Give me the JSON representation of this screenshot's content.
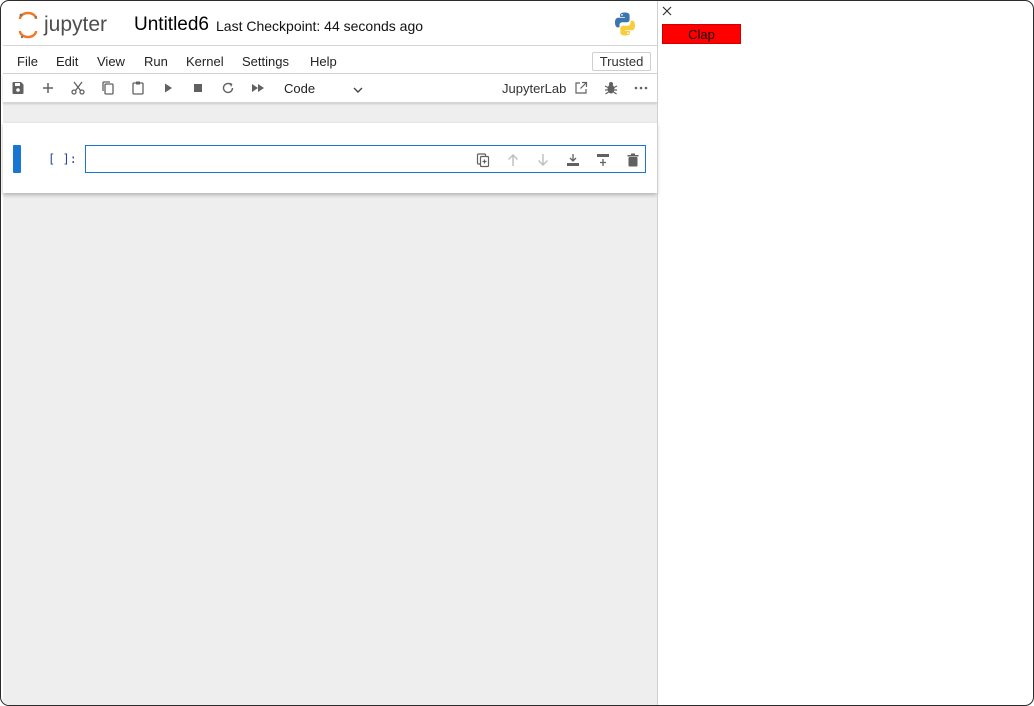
{
  "header": {
    "logo_text": "jupyter",
    "notebook_title": "Untitled6",
    "checkpoint": "Last Checkpoint: 44 seconds ago"
  },
  "menubar": {
    "items": [
      "File",
      "Edit",
      "View",
      "Run",
      "Kernel",
      "Settings",
      "Help"
    ],
    "trusted_label": "Trusted"
  },
  "toolbar": {
    "buttons": [
      "save-icon",
      "add-icon",
      "cut-icon",
      "copy-icon",
      "paste-icon",
      "run-icon",
      "stop-icon",
      "restart-icon",
      "fast-forward-icon"
    ],
    "cell_type": "Code",
    "jupyterlab_label": "JupyterLab",
    "right_icons": [
      "external-link-icon",
      "debugger-icon",
      "more-icon"
    ]
  },
  "cell": {
    "prompt": "[ ]:",
    "toolbar_icons": [
      "duplicate-icon",
      "move-up-icon",
      "move-down-icon",
      "insert-above-icon",
      "insert-below-icon",
      "delete-icon"
    ]
  },
  "side_panel": {
    "clap_label": "Clap"
  },
  "colors": {
    "accent": "#1976d2",
    "jupyter_orange": "#f37726",
    "clap_red": "#ff0000"
  }
}
